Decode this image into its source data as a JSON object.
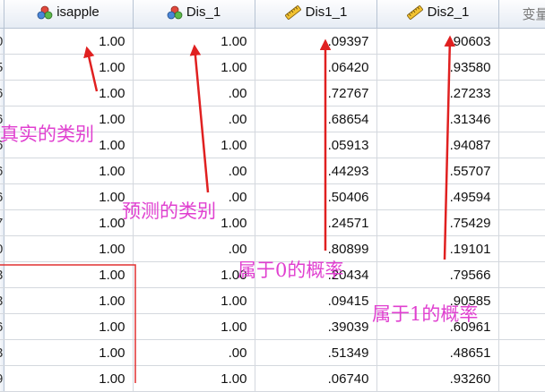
{
  "columns": [
    {
      "label": "isapple",
      "icon": "nominal-icon"
    },
    {
      "label": "Dis_1",
      "icon": "nominal-icon"
    },
    {
      "label": "Dis1_1",
      "icon": "scale-ruler-icon"
    },
    {
      "label": "Dis2_1",
      "icon": "scale-ruler-icon"
    },
    {
      "label": "变量",
      "icon": ""
    }
  ],
  "row_labels": [
    "0",
    "5",
    "6",
    "6",
    "6",
    "6",
    "6",
    "7",
    "0",
    "3",
    "3",
    "6",
    "3",
    "9"
  ],
  "rows": [
    [
      "1.00",
      "1.00",
      ".09397",
      ".90603",
      ""
    ],
    [
      "1.00",
      "1.00",
      ".06420",
      ".93580",
      ""
    ],
    [
      "1.00",
      ".00",
      ".72767",
      ".27233",
      ""
    ],
    [
      "1.00",
      ".00",
      ".68654",
      ".31346",
      ""
    ],
    [
      "1.00",
      "1.00",
      ".05913",
      ".94087",
      ""
    ],
    [
      "1.00",
      ".00",
      ".44293",
      ".55707",
      ""
    ],
    [
      "1.00",
      ".00",
      ".50406",
      ".49594",
      ""
    ],
    [
      "1.00",
      "1.00",
      ".24571",
      ".75429",
      ""
    ],
    [
      "1.00",
      ".00",
      ".80899",
      ".19101",
      ""
    ],
    [
      "1.00",
      "1.00",
      ".20434",
      ".79566",
      ""
    ],
    [
      "1.00",
      "1.00",
      ".09415",
      ".90585",
      ""
    ],
    [
      "1.00",
      "1.00",
      ".39039",
      ".60961",
      ""
    ],
    [
      "1.00",
      ".00",
      ".51349",
      ".48651",
      ""
    ],
    [
      "1.00",
      "1.00",
      ".06740",
      ".93260",
      ""
    ]
  ],
  "annotations": {
    "actual_class": "真实的类别",
    "predicted_class": "预测的类别",
    "prob_0": "属于0的概率",
    "prob_1": "属于1的概率"
  },
  "colors": {
    "annotation": "#e040d0",
    "arrow": "#e02020",
    "highlight_box": "#e03030",
    "header_bg": "#e6ecf4"
  }
}
